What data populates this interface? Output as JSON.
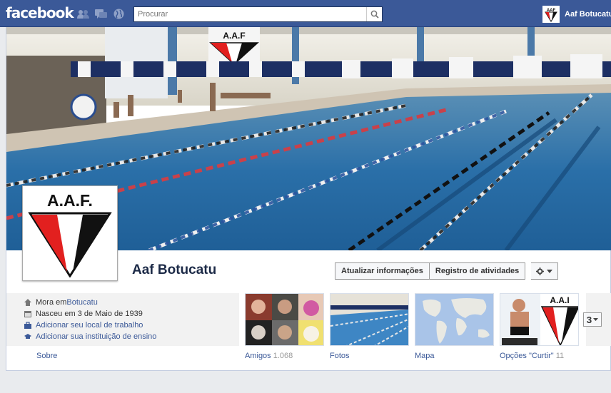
{
  "topbar": {
    "logo": "facebook",
    "search_placeholder": "Procurar",
    "user_name": "Aaf Botucatu",
    "jewels": [
      "friend-requests-icon",
      "messages-icon",
      "notifications-globe-icon"
    ]
  },
  "profile": {
    "name": "Aaf Botucatu",
    "logo_text": "A.A.F.",
    "cover_logo_text": "A.A.F"
  },
  "actions": {
    "update_info": "Atualizar informações",
    "activity_log": "Registro de atividades"
  },
  "info": {
    "lives_prefix": "Mora em ",
    "lives_link": "Botucatu",
    "born": "Nasceu em 3 de Maio de 1939",
    "add_work": "Adicionar seu local de trabalho",
    "add_school": "Adicionar sua instituição de ensino"
  },
  "about_label": "Sobre",
  "thumbs": {
    "friends_label": "Amigos",
    "friends_count": "1.068",
    "photos_label": "Fotos",
    "map_label": "Mapa",
    "likes_label": "Opções \"Curtir\"",
    "likes_count": "11",
    "more_count": "3"
  },
  "colors": {
    "brand": "#3b5998",
    "aaf_red": "#e2201f",
    "aaf_black": "#111111",
    "pool": "#2a6fa8"
  }
}
